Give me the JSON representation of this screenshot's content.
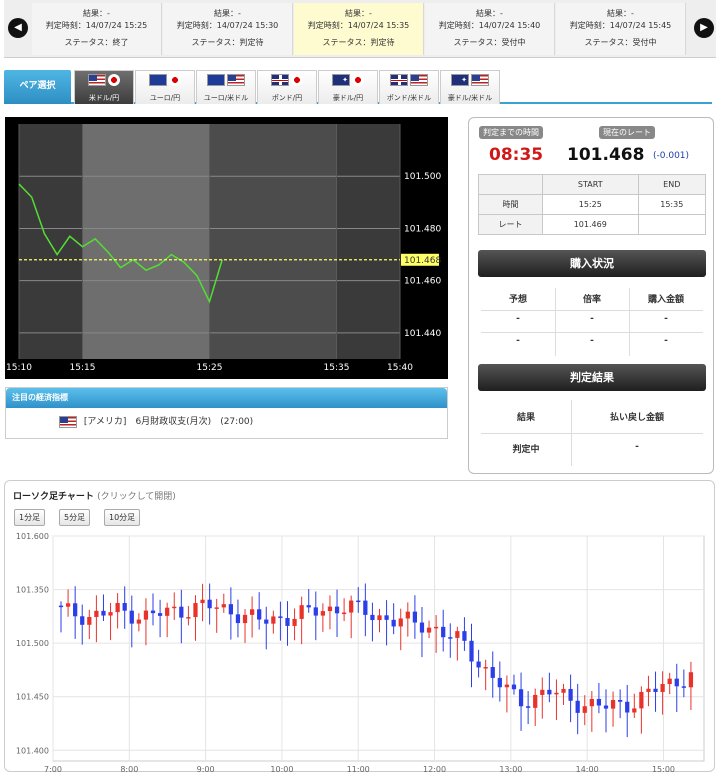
{
  "rounds": [
    {
      "title": "結果：-",
      "deadline": "判定時刻：14/07/24 15:25",
      "status": "ステータス：終了",
      "active": false
    },
    {
      "title": "結果：-",
      "deadline": "判定時刻：14/07/24 15:30",
      "status": "ステータス：判定待",
      "active": false
    },
    {
      "title": "結果：-",
      "deadline": "判定時刻：14/07/24 15:35",
      "status": "ステータス：判定待",
      "active": true
    },
    {
      "title": "結果：-",
      "deadline": "判定時刻：14/07/24 15:40",
      "status": "ステータス：受付中",
      "active": false
    },
    {
      "title": "結果：-",
      "deadline": "判定時刻：14/07/24 15:45",
      "status": "ステータス：受付中",
      "active": false
    }
  ],
  "nav": {
    "prev": "◀",
    "next": "▶"
  },
  "pair_label": "ペア選択",
  "pairs": [
    {
      "name": "米ドル/円",
      "flags": [
        "us",
        "jp"
      ],
      "selected": true
    },
    {
      "name": "ユーロ/円",
      "flags": [
        "eu",
        "jp"
      ],
      "selected": false
    },
    {
      "name": "ユーロ/米ドル",
      "flags": [
        "eu",
        "us"
      ],
      "selected": false
    },
    {
      "name": "ポンド/円",
      "flags": [
        "uk",
        "jp"
      ],
      "selected": false
    },
    {
      "name": "豪ドル/円",
      "flags": [
        "au",
        "jp"
      ],
      "selected": false
    },
    {
      "name": "ポンド/米ドル",
      "flags": [
        "uk",
        "us"
      ],
      "selected": false
    },
    {
      "name": "豪ドル/米ドル",
      "flags": [
        "au",
        "us"
      ],
      "selected": false
    }
  ],
  "rate_chart": {
    "x_ticks": [
      "15:10",
      "15:15",
      "15:25",
      "15:35",
      "15:40"
    ],
    "y_ticks": [
      "101.500",
      "101.480",
      "101.460",
      "101.440"
    ],
    "current_label": "101.468",
    "line_color": "#55dd33",
    "current_line_color": "#ffff66"
  },
  "indicator": {
    "title": "注目の経済指標",
    "flag": "us",
    "text": "[アメリカ]　6月財政収支(月次)　(27:00)"
  },
  "panel": {
    "time_tag": "判定までの時間",
    "countdown": "08:35",
    "rate_tag": "現在のレート",
    "rate": "101.468",
    "change": "(-0.001)",
    "table": {
      "header": [
        "",
        "START",
        "END"
      ],
      "rows": [
        [
          "時間",
          "15:25",
          "15:35"
        ],
        [
          "レート",
          "101.469",
          ""
        ]
      ]
    },
    "purchase_title": "購入状況",
    "purchase_cols": [
      "予想",
      "倍率",
      "購入金額"
    ],
    "purchase_rows": [
      [
        "-",
        "-",
        "-"
      ],
      [
        "-",
        "-",
        "-"
      ]
    ],
    "result_title": "判定結果",
    "result_cols": [
      "結果",
      "払い戻し金額"
    ],
    "result_row": [
      "判定中",
      "-"
    ]
  },
  "candle": {
    "title": "ローソク足チャート",
    "subtitle": "(クリックして開閉)",
    "buttons": [
      "1分足",
      "5分足",
      "10分足"
    ],
    "y_ticks": [
      "101.600",
      "101.350",
      "101.500",
      "101.450",
      "101.400"
    ],
    "x_ticks": [
      "7:00",
      "8:00",
      "9:00",
      "10:00",
      "11:00",
      "12:00",
      "13:00",
      "14:00",
      "15:00"
    ],
    "up_color": "#e8332b",
    "down_color": "#2b3ee8"
  },
  "chart_data": [
    {
      "type": "line",
      "x_ticks": [
        "15:10",
        "15:15",
        "15:25",
        "15:35",
        "15:40"
      ],
      "ylim": [
        101.43,
        101.52
      ],
      "current": 101.468,
      "series": [
        {
          "x": [
            "15:10",
            "15:11",
            "15:12",
            "15:13",
            "15:14",
            "15:15",
            "15:16",
            "15:17",
            "15:18",
            "15:19",
            "15:20",
            "15:21",
            "15:22",
            "15:23",
            "15:24",
            "15:25",
            "15:26"
          ],
          "values": [
            101.497,
            101.492,
            101.478,
            101.47,
            101.477,
            101.473,
            101.476,
            101.471,
            101.465,
            101.468,
            101.464,
            101.466,
            101.47,
            101.467,
            101.462,
            101.452,
            101.468
          ]
        }
      ]
    },
    {
      "type": "candlestick",
      "x_ticks": [
        "7:00",
        "8:00",
        "9:00",
        "10:00",
        "11:00",
        "12:00",
        "13:00",
        "14:00",
        "15:00"
      ],
      "ylim": [
        101.39,
        101.6
      ],
      "series": [
        {
          "open": [
            101.535,
            101.53,
            101.525,
            101.53,
            101.525,
            101.53,
            101.535,
            101.53,
            101.52,
            101.525,
            101.53,
            101.53,
            101.525,
            101.52,
            101.51,
            101.5,
            101.46,
            101.445,
            101.455,
            101.445,
            101.44,
            101.445,
            101.465
          ],
          "close": [
            101.53,
            101.525,
            101.53,
            101.525,
            101.53,
            101.535,
            101.53,
            101.52,
            101.525,
            101.53,
            101.535,
            101.525,
            101.52,
            101.515,
            101.5,
            101.47,
            101.445,
            101.455,
            101.445,
            101.44,
            101.445,
            101.46,
            101.47
          ]
        }
      ]
    }
  ]
}
